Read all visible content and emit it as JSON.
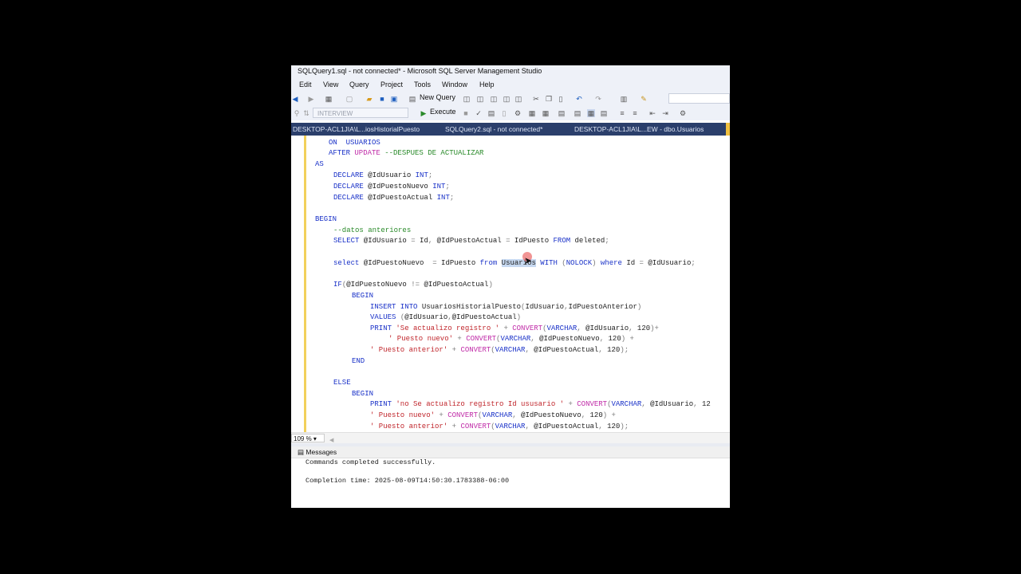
{
  "window": {
    "title": "SQLQuery1.sql - not connected* - Microsoft SQL Server Management Studio"
  },
  "menu": [
    "Edit",
    "View",
    "Query",
    "Project",
    "Tools",
    "Window",
    "Help"
  ],
  "toolbar": {
    "new_query_label": "New Query",
    "database_selector": "INTERVIEW",
    "execute_label": "Execute"
  },
  "tabs": [
    {
      "label": "DESKTOP-ACL1JIA\\L...iosHistorialPuesto",
      "active": false
    },
    {
      "label": "SQLQuery2.sql - not connected*",
      "active": false
    },
    {
      "label": "DESKTOP-ACL1JIA\\L...EW - dbo.Usuarios",
      "active": false
    }
  ],
  "status": {
    "zoom": "109 %"
  },
  "results": {
    "tab_label": "Messages",
    "message": "Commands completed successfully.",
    "completion": "Completion time: 2025-08-09T14:50:30.1783388-06:00"
  },
  "colors": {
    "keyword": "#1a32c8",
    "comment": "#2a8a2a",
    "string": "#c0262c",
    "function": "#c02ca8",
    "tab_strip": "#2b3f6b",
    "modified_bar": "#f2d05b"
  },
  "code_lines": [
    [
      [
        "ON  USUARIOS",
        "kw"
      ]
    ],
    [
      [
        "AFTER ",
        "kw"
      ],
      [
        "UPDATE ",
        "fn"
      ],
      [
        "--DESPUES DE ACTUALIZAR",
        "cm"
      ]
    ],
    [
      [
        "AS",
        "kw"
      ]
    ],
    [
      [
        "DECLARE ",
        "kw"
      ],
      [
        "@IdUsuario ",
        ""
      ],
      [
        "INT",
        "kw"
      ],
      [
        ";",
        "gr"
      ]
    ],
    [
      [
        "DECLARE ",
        "kw"
      ],
      [
        "@IdPuestoNuevo ",
        ""
      ],
      [
        "INT",
        "kw"
      ],
      [
        ";",
        "gr"
      ]
    ],
    [
      [
        "DECLARE ",
        "kw"
      ],
      [
        "@IdPuestoActual ",
        ""
      ],
      [
        "INT",
        "kw"
      ],
      [
        ";",
        "gr"
      ]
    ],
    [
      [
        "",
        ""
      ]
    ],
    [
      [
        "BEGIN",
        "kw"
      ]
    ],
    [
      [
        "--datos anteriores",
        "cm"
      ]
    ],
    [
      [
        "SELECT ",
        "kw"
      ],
      [
        "@IdUsuario ",
        ""
      ],
      [
        "= ",
        "gr"
      ],
      [
        "Id",
        ""
      ],
      [
        ", ",
        "gr"
      ],
      [
        "@IdPuestoActual ",
        ""
      ],
      [
        "= ",
        "gr"
      ],
      [
        "IdPuesto ",
        ""
      ],
      [
        "FROM ",
        "kw"
      ],
      [
        "deleted",
        ""
      ],
      [
        ";",
        "gr"
      ]
    ],
    [
      [
        "",
        ""
      ]
    ],
    [
      [
        "select ",
        "kw"
      ],
      [
        "@IdPuestoNuevo  ",
        ""
      ],
      [
        "= ",
        "gr"
      ],
      [
        "IdPuesto ",
        ""
      ],
      [
        "from ",
        "kw"
      ],
      [
        "Usuarios",
        "sel"
      ],
      [
        " WITH ",
        "kw"
      ],
      [
        "(",
        "gr"
      ],
      [
        "NOLOCK",
        "kw"
      ],
      [
        ") ",
        "gr"
      ],
      [
        "where ",
        "kw"
      ],
      [
        "Id ",
        ""
      ],
      [
        "= ",
        "gr"
      ],
      [
        "@IdUsuario",
        ""
      ],
      [
        ";",
        "gr"
      ]
    ],
    [
      [
        "",
        ""
      ]
    ],
    [
      [
        "IF",
        "kw"
      ],
      [
        "(",
        "gr"
      ],
      [
        "@IdPuestoNuevo ",
        ""
      ],
      [
        "!= ",
        "gr"
      ],
      [
        "@IdPuestoActual",
        ""
      ],
      [
        ")",
        "gr"
      ]
    ],
    [
      [
        "BEGIN",
        "kw"
      ]
    ],
    [
      [
        "INSERT INTO ",
        "kw"
      ],
      [
        "UsuariosHistorialPuesto",
        ""
      ],
      [
        "(",
        "gr"
      ],
      [
        "IdUsuario",
        ""
      ],
      [
        ",",
        "gr"
      ],
      [
        "IdPuestoAnterior",
        ""
      ],
      [
        ")",
        "gr"
      ]
    ],
    [
      [
        "VALUES ",
        "kw"
      ],
      [
        "(",
        "gr"
      ],
      [
        "@IdUsuario",
        ""
      ],
      [
        ",",
        "gr"
      ],
      [
        "@IdPuestoActual",
        ""
      ],
      [
        ")",
        "gr"
      ]
    ],
    [
      [
        "PRINT ",
        "kw"
      ],
      [
        "'Se actualizo registro ' ",
        "str"
      ],
      [
        "+ ",
        "gr"
      ],
      [
        "CONVERT",
        "fn"
      ],
      [
        "(",
        "gr"
      ],
      [
        "VARCHAR",
        "kw"
      ],
      [
        ", ",
        "gr"
      ],
      [
        "@IdUsuario",
        ""
      ],
      [
        ", ",
        "gr"
      ],
      [
        "120",
        ""
      ],
      [
        ")+",
        "gr"
      ]
    ],
    [
      [
        "' Puesto nuevo' ",
        "str"
      ],
      [
        "+ ",
        "gr"
      ],
      [
        "CONVERT",
        "fn"
      ],
      [
        "(",
        "gr"
      ],
      [
        "VARCHAR",
        "kw"
      ],
      [
        ", ",
        "gr"
      ],
      [
        "@IdPuestoNuevo",
        ""
      ],
      [
        ", ",
        "gr"
      ],
      [
        "120",
        ""
      ],
      [
        ") +",
        "gr"
      ]
    ],
    [
      [
        "' Puesto anterior' ",
        "str"
      ],
      [
        "+ ",
        "gr"
      ],
      [
        "CONVERT",
        "fn"
      ],
      [
        "(",
        "gr"
      ],
      [
        "VARCHAR",
        "kw"
      ],
      [
        ", ",
        "gr"
      ],
      [
        "@IdPuestoActual",
        ""
      ],
      [
        ", ",
        "gr"
      ],
      [
        "120",
        ""
      ],
      [
        ");",
        "gr"
      ]
    ],
    [
      [
        "END",
        "kw"
      ]
    ],
    [
      [
        "",
        ""
      ]
    ],
    [
      [
        "ELSE",
        "kw"
      ]
    ],
    [
      [
        "BEGIN",
        "kw"
      ]
    ],
    [
      [
        "PRINT ",
        "kw"
      ],
      [
        "'no Se actualizo registro Id ususario ' ",
        "str"
      ],
      [
        "+ ",
        "gr"
      ],
      [
        "CONVERT",
        "fn"
      ],
      [
        "(",
        "gr"
      ],
      [
        "VARCHAR",
        "kw"
      ],
      [
        ", ",
        "gr"
      ],
      [
        "@IdUsuario",
        ""
      ],
      [
        ", ",
        "gr"
      ],
      [
        "12",
        ""
      ]
    ],
    [
      [
        "' Puesto nuevo' ",
        "str"
      ],
      [
        "+ ",
        "gr"
      ],
      [
        "CONVERT",
        "fn"
      ],
      [
        "(",
        "gr"
      ],
      [
        "VARCHAR",
        "kw"
      ],
      [
        ", ",
        "gr"
      ],
      [
        "@IdPuestoNuevo",
        ""
      ],
      [
        ", ",
        "gr"
      ],
      [
        "120",
        ""
      ],
      [
        ") +",
        "gr"
      ]
    ],
    [
      [
        "' Puesto anterior' ",
        "str"
      ],
      [
        "+ ",
        "gr"
      ],
      [
        "CONVERT",
        "fn"
      ],
      [
        "(",
        "gr"
      ],
      [
        "VARCHAR",
        "kw"
      ],
      [
        ", ",
        "gr"
      ],
      [
        "@IdPuestoActual",
        ""
      ],
      [
        ", ",
        "gr"
      ],
      [
        "120",
        ""
      ],
      [
        ");",
        "gr"
      ]
    ]
  ]
}
